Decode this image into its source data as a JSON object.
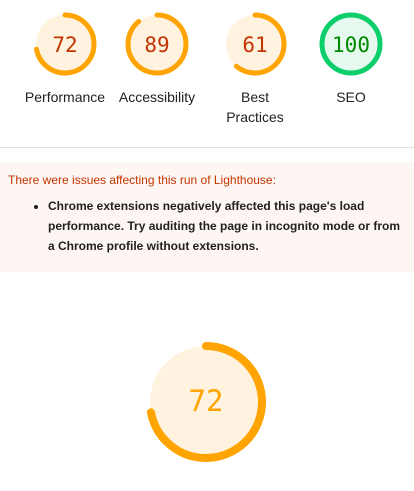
{
  "gauges": [
    {
      "label": "Performance",
      "score": "72",
      "value": 72,
      "rating": "average"
    },
    {
      "label": "Accessibility",
      "score": "89",
      "value": 89,
      "rating": "average"
    },
    {
      "label": "Best Practices",
      "score": "61",
      "value": 61,
      "rating": "average"
    },
    {
      "label": "SEO",
      "score": "100",
      "value": 100,
      "rating": "pass"
    }
  ],
  "colors": {
    "average": {
      "arc": "#ffa400",
      "fill": "#fff3e0",
      "text": "#c33300"
    },
    "pass": {
      "arc": "#0cce6b",
      "fill": "#e6f9ee",
      "text": "#008800"
    },
    "big_text": "#ffa400"
  },
  "warning": {
    "title": "There were issues affecting this run of Lighthouse:",
    "items": [
      "Chrome extensions negatively affected this page's load performance. Try auditing the page in incognito mode or from a Chrome profile without extensions."
    ]
  },
  "main_gauge": {
    "score": "72",
    "value": 72
  }
}
